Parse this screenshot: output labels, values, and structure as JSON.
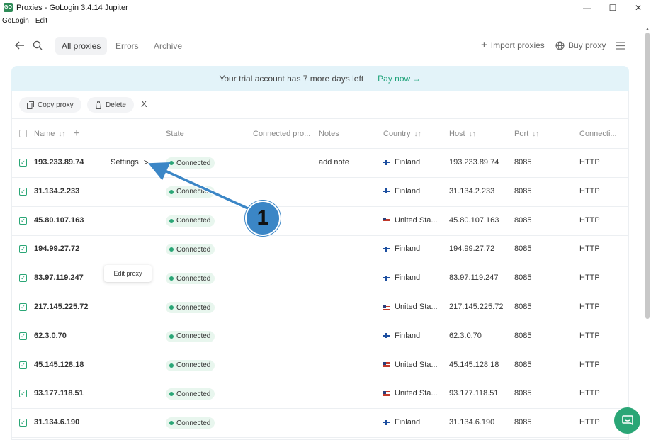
{
  "window": {
    "title": "Proxies - GoLogin 3.4.14 Jupiter",
    "app_icon_text": "GO",
    "minimize": "—",
    "maximize": "☐",
    "close": "✕"
  },
  "menu": [
    "GoLogin",
    "Edit"
  ],
  "nav": {
    "tabs": [
      {
        "label": "All proxies",
        "active": true
      },
      {
        "label": "Errors",
        "active": false
      },
      {
        "label": "Archive",
        "active": false
      }
    ],
    "import_label": "Import proxies",
    "buy_label": "Buy proxy"
  },
  "banner": {
    "text": "Your trial account has 7 more days left",
    "pay_label": "Pay now →"
  },
  "toolbar": {
    "copy_label": "Copy proxy",
    "delete_label": "Delete",
    "close_label": "X"
  },
  "columns": {
    "name": "Name",
    "state": "State",
    "connected": "Connected pro...",
    "notes": "Notes",
    "country": "Country",
    "host": "Host",
    "port": "Port",
    "connection": "Connecti..."
  },
  "rows": [
    {
      "name": "193.233.89.74",
      "state": "Connected",
      "notes": "add note",
      "country": "Finland",
      "flag": "fi",
      "host": "193.233.89.74",
      "port": "8085",
      "conn": "HTTP"
    },
    {
      "name": "31.134.2.233",
      "state": "Connected",
      "notes": "",
      "country": "Finland",
      "flag": "fi",
      "host": "31.134.2.233",
      "port": "8085",
      "conn": "HTTP"
    },
    {
      "name": "45.80.107.163",
      "state": "Connected",
      "notes": "",
      "country": "United Sta...",
      "flag": "us",
      "host": "45.80.107.163",
      "port": "8085",
      "conn": "HTTP"
    },
    {
      "name": "194.99.27.72",
      "state": "Connected",
      "notes": "",
      "country": "Finland",
      "flag": "fi",
      "host": "194.99.27.72",
      "port": "8085",
      "conn": "HTTP"
    },
    {
      "name": "83.97.119.247",
      "state": "Connected",
      "notes": "",
      "country": "Finland",
      "flag": "fi",
      "host": "83.97.119.247",
      "port": "8085",
      "conn": "HTTP"
    },
    {
      "name": "217.145.225.72",
      "state": "Connected",
      "notes": "",
      "country": "United Sta...",
      "flag": "us",
      "host": "217.145.225.72",
      "port": "8085",
      "conn": "HTTP"
    },
    {
      "name": "62.3.0.70",
      "state": "Connected",
      "notes": "",
      "country": "Finland",
      "flag": "fi",
      "host": "62.3.0.70",
      "port": "8085",
      "conn": "HTTP"
    },
    {
      "name": "45.145.128.18",
      "state": "Connected",
      "notes": "",
      "country": "United Sta...",
      "flag": "us",
      "host": "45.145.128.18",
      "port": "8085",
      "conn": "HTTP"
    },
    {
      "name": "93.177.118.51",
      "state": "Connected",
      "notes": "",
      "country": "United Sta...",
      "flag": "us",
      "host": "93.177.118.51",
      "port": "8085",
      "conn": "HTTP"
    },
    {
      "name": "31.134.6.190",
      "state": "Connected",
      "notes": "",
      "country": "Finland",
      "flag": "fi",
      "host": "31.134.6.190",
      "port": "8085",
      "conn": "HTTP"
    }
  ],
  "row_action": {
    "settings_label": "Settings",
    "tooltip": "Edit proxy"
  },
  "callout": {
    "number": "1"
  },
  "colors": {
    "accent": "#2aa676",
    "banner": "#e3f3f9",
    "callout": "#3b86c6"
  }
}
